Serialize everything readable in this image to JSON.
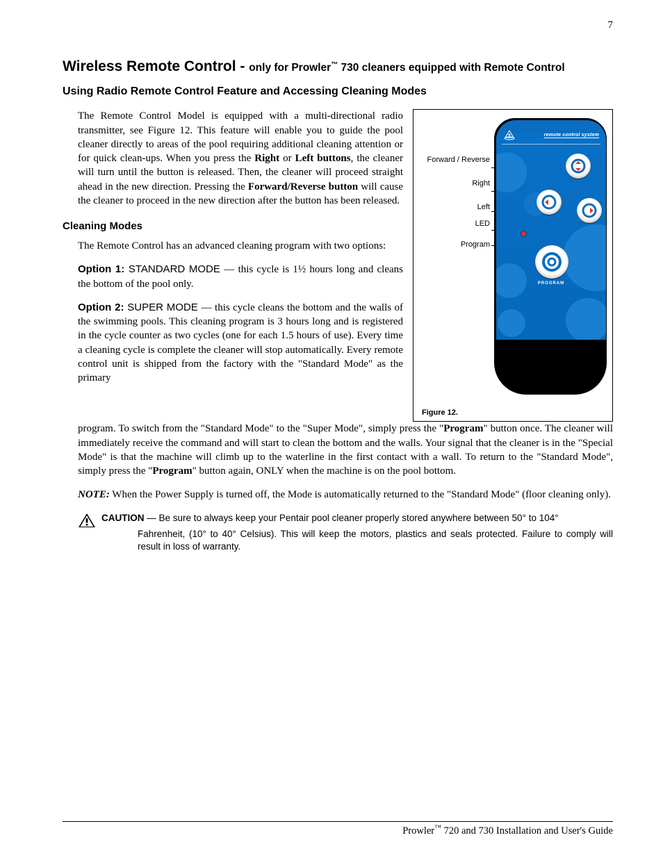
{
  "page_number": "7",
  "title_main": "Wireless Remote Control - ",
  "title_sub_pre": "only for Prowler",
  "title_tm": "™",
  "title_sub_post": " 730 cleaners equipped with Remote Control",
  "h2": "Using Radio Remote Control Feature and Accessing Cleaning Modes",
  "para_intro": "The Remote Control Model is equipped with a multi-directional radio transmitter, see Figure 12. This feature will enable you to guide the pool cleaner directly to areas of the pool requiring additional cleaning attention or for quick clean-ups. When you press the ",
  "para_intro_b1": "Right",
  "para_intro_mid1": " or ",
  "para_intro_b2": "Left buttons",
  "para_intro_mid2": ", the cleaner will turn until the button is released. Then, the cleaner will proceed straight ahead in the new direction. Pressing the ",
  "para_intro_b3": "Forward/Reverse button",
  "para_intro_end": " will cause the cleaner to proceed in the new direction after the button has been released.",
  "h3_modes": "Cleaning Modes",
  "p_modes_intro": "The Remote Control has an advanced cleaning program with two options:",
  "opt1_lead": "Option 1:",
  "opt1_mode": " STANDARD MODE ",
  "opt1_body": "— this cycle is 1½ hours long and cleans the bottom of the pool only.",
  "opt2_lead": "Option 2:",
  "opt2_mode": " SUPER MODE ",
  "opt2_body_left": "— this cycle cleans the bottom and the walls of the swimming pools. This cleaning program is 3 hours long and is registered in the cycle counter as two cycles (one for each 1.5 hours of use). Every time a cleaning cycle is complete the cleaner will stop automatically. Every remote control unit is shipped from the factory with the \"Standard Mode\" as the primary",
  "opt2_body_full_a": "program. To switch from the \"Standard Mode\" to the \"Super Mode\", simply press the \"",
  "opt2_body_full_b1": "Program",
  "opt2_body_full_b": "\" button once. The cleaner will immediately receive the command and will start to clean the bottom and the walls. Your signal that the cleaner is in the \"Special Mode\" is that the machine will climb up to the waterline in the first contact with a wall. To return to the \"Standard Mode\", simply press the \"",
  "opt2_body_full_b2": "Program",
  "opt2_body_full_c": "\" button again, ONLY when the machine is on the pool bottom.",
  "note_lead": "NOTE:",
  "note_body": " When the Power Supply is turned off, the Mode is automatically returned to the \"Standard Mode\" (floor cleaning only).",
  "caution_lead": "CAUTION",
  "caution_dash": " — ",
  "caution_first": "Be sure to always keep your Pentair pool cleaner properly stored anywhere between 50° to 104°",
  "caution_rest": "Fahrenheit, (10° to 40° Celsius). This will keep the motors, plastics and seals protected. Failure to comply will result in loss of warranty.",
  "figure": {
    "labels": {
      "fwd_rev": "Forward / Reverse",
      "right": "Right",
      "left": "Left",
      "led": "LED",
      "program": "Program"
    },
    "brand": "remote control system",
    "program_btn_label": "PROGRAM",
    "caption": "Figure 12."
  },
  "footer_pre": "Prowler",
  "footer_tm": "™",
  "footer_post": " 720 and 730 Installation and User's Guide"
}
